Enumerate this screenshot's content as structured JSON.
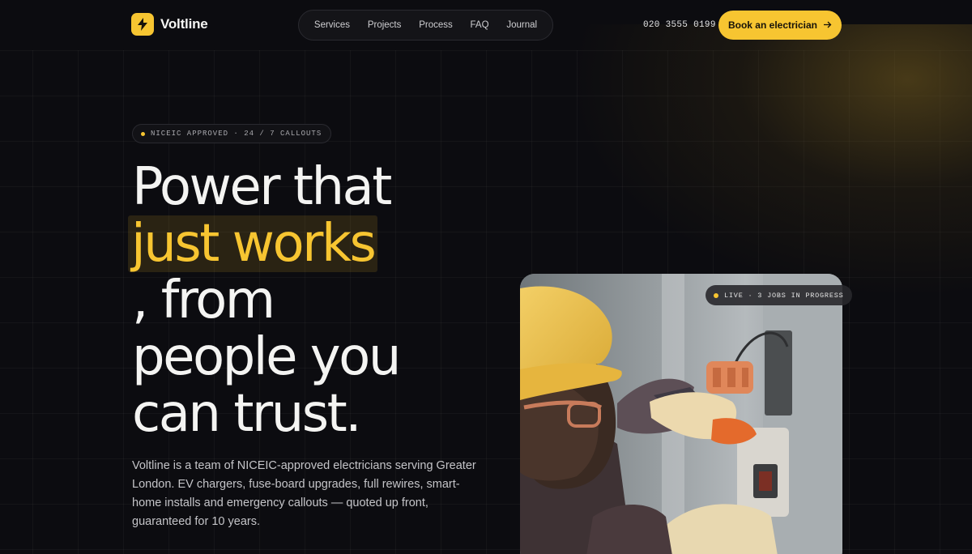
{
  "brand": {
    "name": "Voltline",
    "logo_icon": "lightning-bolt-icon",
    "accent": "#f7c531"
  },
  "nav": {
    "items": [
      {
        "label": "Services"
      },
      {
        "label": "Projects"
      },
      {
        "label": "Process"
      },
      {
        "label": "FAQ"
      },
      {
        "label": "Journal"
      }
    ]
  },
  "header": {
    "phone": "020 3555 0199",
    "cta_label": "Book an electrician",
    "cta_icon": "arrow-right-icon"
  },
  "hero": {
    "badge": "NICEIC APPROVED · 24 / 7 CALLOUTS",
    "headline": {
      "line1": "Power that",
      "highlight": "just works",
      "line3": ", from",
      "line4": "people you",
      "line5": "can trust."
    },
    "description": "Voltline is a team of NICEIC-approved electricians serving Greater London. EV chargers, fuse-board upgrades, full rewires, smart-home installs and emergency callouts — quoted up front, guaranteed for 10 years."
  },
  "photo_card": {
    "live_badge": "LIVE · 3 JOBS IN PROGRESS",
    "image": "electrician-working-on-wall-fixture"
  },
  "colors": {
    "background": "#0c0c10",
    "accent": "#f7c531",
    "text": "#f4f4f2"
  }
}
